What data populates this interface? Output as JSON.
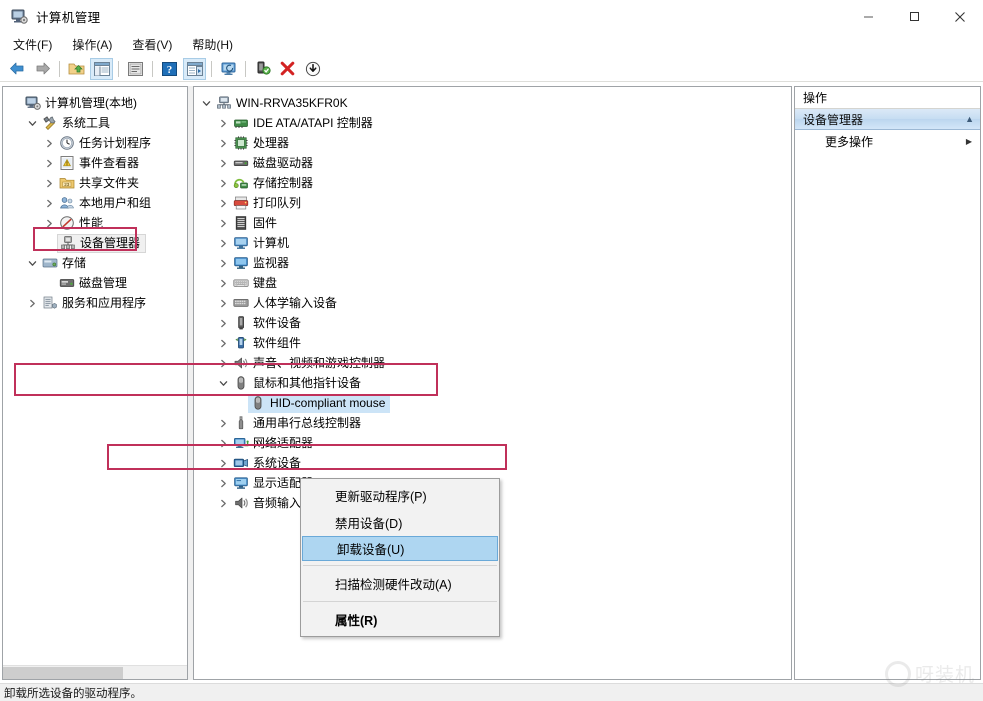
{
  "window": {
    "title": "计算机管理",
    "app_icon": "computer-management-icon",
    "minimize_label": "–",
    "maximize_label": "☐",
    "close_label": "✕"
  },
  "menubar": {
    "items": [
      {
        "label": "文件(F)",
        "name": "menu-file"
      },
      {
        "label": "操作(A)",
        "name": "menu-action"
      },
      {
        "label": "查看(V)",
        "name": "menu-view"
      },
      {
        "label": "帮助(H)",
        "name": "menu-help"
      }
    ]
  },
  "toolbar": {
    "buttons": [
      {
        "icon": "back-arrow-icon",
        "title": "后退",
        "pressed": false
      },
      {
        "icon": "forward-arrow-icon",
        "title": "前进",
        "pressed": false
      },
      {
        "icon": "up-folder-icon",
        "title": "上一级",
        "pressed": false
      },
      {
        "icon": "show-hide-tree-icon",
        "title": "显示/隐藏控制台树",
        "pressed": true
      },
      {
        "icon": "properties-icon",
        "title": "属性",
        "pressed": false
      },
      {
        "icon": "help-icon",
        "title": "帮助",
        "pressed": false
      },
      {
        "icon": "export-list-icon",
        "title": "导出列表",
        "pressed": true
      },
      {
        "icon": "refresh-monitor-icon",
        "title": "刷新",
        "pressed": false
      },
      {
        "icon": "scan-hardware-icon",
        "title": "扫描检测硬件改动",
        "pressed": false
      },
      {
        "icon": "uninstall-device-icon",
        "title": "卸载设备",
        "pressed": false
      },
      {
        "icon": "update-driver-icon",
        "title": "更新驱动程序",
        "pressed": false
      }
    ]
  },
  "sidebar": {
    "items": [
      {
        "label": "计算机管理(本地)",
        "icon": "computer-management-icon",
        "indent": 0,
        "twisty": "",
        "state": "normal"
      },
      {
        "label": "系统工具",
        "icon": "system-tools-icon",
        "indent": 1,
        "twisty": "v",
        "state": "normal"
      },
      {
        "label": "任务计划程序",
        "icon": "task-scheduler-icon",
        "indent": 2,
        "twisty": ">",
        "state": "normal"
      },
      {
        "label": "事件查看器",
        "icon": "event-viewer-icon",
        "indent": 2,
        "twisty": ">",
        "state": "normal"
      },
      {
        "label": "共享文件夹",
        "icon": "shared-folders-icon",
        "indent": 2,
        "twisty": ">",
        "state": "normal"
      },
      {
        "label": "本地用户和组",
        "icon": "local-users-groups-icon",
        "indent": 2,
        "twisty": ">",
        "state": "normal"
      },
      {
        "label": "性能",
        "icon": "performance-icon",
        "indent": 2,
        "twisty": ">",
        "state": "normal"
      },
      {
        "label": "设备管理器",
        "icon": "device-manager-icon",
        "indent": 2,
        "twisty": "",
        "state": "selected-gray"
      },
      {
        "label": "存储",
        "icon": "storage-icon",
        "indent": 1,
        "twisty": "v",
        "state": "normal"
      },
      {
        "label": "磁盘管理",
        "icon": "disk-management-icon",
        "indent": 2,
        "twisty": "",
        "state": "normal"
      },
      {
        "label": "服务和应用程序",
        "icon": "services-apps-icon",
        "indent": 1,
        "twisty": ">",
        "state": "normal"
      }
    ]
  },
  "device_tree": {
    "items": [
      {
        "label": "WIN-RRVA35KFR0K",
        "icon": "computer-node-icon",
        "indent": 0,
        "twisty": "v",
        "state": "normal"
      },
      {
        "label": "IDE ATA/ATAPI 控制器",
        "icon": "ide-controller-icon",
        "indent": 1,
        "twisty": ">",
        "state": "normal"
      },
      {
        "label": "处理器",
        "icon": "processor-icon",
        "indent": 1,
        "twisty": ">",
        "state": "normal"
      },
      {
        "label": "磁盘驱动器",
        "icon": "disk-drive-icon",
        "indent": 1,
        "twisty": ">",
        "state": "normal"
      },
      {
        "label": "存储控制器",
        "icon": "storage-controller-icon",
        "indent": 1,
        "twisty": ">",
        "state": "normal"
      },
      {
        "label": "打印队列",
        "icon": "print-queue-icon",
        "indent": 1,
        "twisty": ">",
        "state": "normal"
      },
      {
        "label": "固件",
        "icon": "firmware-icon",
        "indent": 1,
        "twisty": ">",
        "state": "normal"
      },
      {
        "label": "计算机",
        "icon": "computer-icon",
        "indent": 1,
        "twisty": ">",
        "state": "normal"
      },
      {
        "label": "监视器",
        "icon": "monitor-icon",
        "indent": 1,
        "twisty": ">",
        "state": "normal"
      },
      {
        "label": "键盘",
        "icon": "keyboard-icon",
        "indent": 1,
        "twisty": ">",
        "state": "normal"
      },
      {
        "label": "人体学输入设备",
        "icon": "hid-icon",
        "indent": 1,
        "twisty": ">",
        "state": "normal"
      },
      {
        "label": "软件设备",
        "icon": "software-device-icon",
        "indent": 1,
        "twisty": ">",
        "state": "normal"
      },
      {
        "label": "软件组件",
        "icon": "software-component-icon",
        "indent": 1,
        "twisty": ">",
        "state": "normal"
      },
      {
        "label": "声音、视频和游戏控制器",
        "icon": "sound-video-game-icon",
        "indent": 1,
        "twisty": ">",
        "state": "normal"
      },
      {
        "label": "鼠标和其他指针设备",
        "icon": "mouse-icon",
        "indent": 1,
        "twisty": "v",
        "state": "normal"
      },
      {
        "label": "HID-compliant mouse",
        "icon": "mouse-icon",
        "indent": 2,
        "twisty": "",
        "state": "selected-blue"
      },
      {
        "label": "通用串行总线控制器",
        "icon": "usb-controller-icon",
        "indent": 1,
        "twisty": ">",
        "state": "normal"
      },
      {
        "label": "网络适配器",
        "icon": "network-adapter-icon",
        "indent": 1,
        "twisty": ">",
        "state": "normal"
      },
      {
        "label": "系统设备",
        "icon": "system-device-icon",
        "indent": 1,
        "twisty": ">",
        "state": "normal"
      },
      {
        "label": "显示适配器",
        "icon": "display-adapter-icon",
        "indent": 1,
        "twisty": ">",
        "state": "normal"
      },
      {
        "label": "音频输入和输出",
        "icon": "audio-io-icon",
        "indent": 1,
        "twisty": ">",
        "state": "normal"
      }
    ]
  },
  "actions_pane": {
    "title": "操作",
    "group_label": "设备管理器",
    "group_chevron": "▲",
    "items": [
      {
        "label": "更多操作",
        "submenu_arrow": "▶"
      }
    ]
  },
  "context_menu": {
    "items": [
      {
        "label": "更新驱动程序(P)",
        "active": false,
        "bold": false,
        "separator_after": false
      },
      {
        "label": "禁用设备(D)",
        "active": false,
        "bold": false,
        "separator_after": false
      },
      {
        "label": "卸载设备(U)",
        "active": true,
        "bold": false,
        "separator_after": true
      },
      {
        "label": "扫描检测硬件改动(A)",
        "active": false,
        "bold": false,
        "separator_after": true
      },
      {
        "label": "属性(R)",
        "active": false,
        "bold": true,
        "separator_after": false
      }
    ]
  },
  "statusbar": {
    "text": "卸载所选设备的驱动程序。"
  },
  "watermark": {
    "text": "呀装机"
  },
  "colors": {
    "annotation": "#c0305a",
    "selection_blue": "#cce4f7",
    "menu_highlight": "#aed6f1",
    "actions_header": "#c6ddf2",
    "toolbar_pressed": "#d9ebf9"
  }
}
